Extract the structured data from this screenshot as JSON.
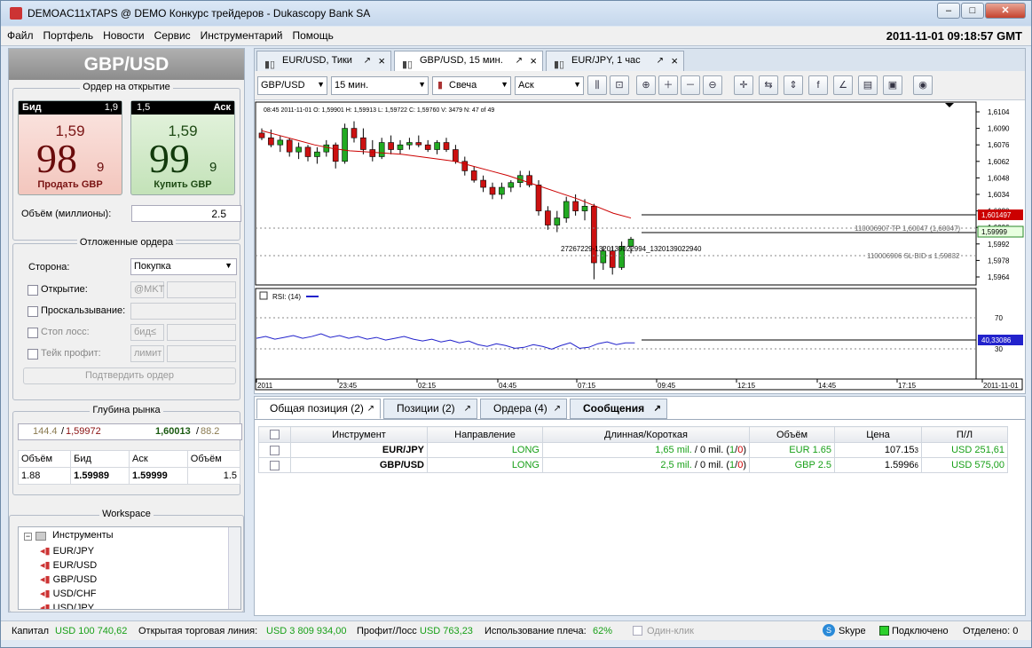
{
  "window": {
    "title": "DEMOAC11xTAPS @ DEMO Конкурс трейдеров - Dukascopy Bank SA",
    "min": "‒",
    "max": "□",
    "close": "✕"
  },
  "menu": [
    "Файл",
    "Портфель",
    "Новости",
    "Сервис",
    "Инструментарий",
    "Помощь"
  ],
  "clock": "2011-11-01 09:18:57 GMT",
  "left": {
    "instrument": "GBP/USD",
    "order_title": "Ордер на открытие",
    "bid": {
      "label": "Бид",
      "spread": "1,9",
      "small": "1,59",
      "big": "98",
      "sup": "9",
      "action": "Продать GBP"
    },
    "ask": {
      "label": "Аск",
      "spread": "1,5",
      "small": "1,59",
      "big": "99",
      "sup": "9",
      "action": "Купить GBP"
    },
    "volume_label": "Объём (миллионы):",
    "volume": "2.5",
    "pending_title": "Отложенные ордера",
    "side_label": "Сторона:",
    "side": "Покупка",
    "open_label": "Открытие:",
    "open_ph": "@MKT",
    "slip_label": "Проскальзывание:",
    "sl_label": "Стоп лосс:",
    "sl_ph": "бид≤",
    "tp_label": "Тейк профит:",
    "tp_ph": "лимит",
    "confirm": "Подтвердить ордер",
    "depth_title": "Глубина рынка",
    "depth": {
      "bid_vol": "144.4",
      "bid": "1,59972",
      "ask": "1,60013",
      "ask_vol": "88.2"
    },
    "depth_cols": [
      "Объём",
      "Бид",
      "Аск",
      "Объём"
    ],
    "depth_row": [
      "1.88",
      "1.59989",
      "1.59999",
      "1.5"
    ],
    "workspace_title": "Workspace",
    "tree_root": "Инструменты",
    "tree": [
      "EUR/JPY",
      "EUR/USD",
      "GBP/USD",
      "USD/CHF",
      "USD/JPY"
    ]
  },
  "tabs": [
    {
      "label": "EUR/USD, Тики"
    },
    {
      "label": "GBP/USD, 15 мин."
    },
    {
      "label": "EUR/JPY, 1 час"
    }
  ],
  "toolbar": {
    "instrument": "GBP/USD",
    "period": "15 мин.",
    "type": "Свеча",
    "side": "Аск"
  },
  "chart_data": {
    "type": "candlestick",
    "info": "08:45 2011-11-01   O: 1,59901   H: 1,59913   L: 1,59722   C: 1,59760   V: 3479   N: 47 of 49",
    "yticks": [
      "1,6104",
      "1,6090",
      "1,6076",
      "1,6062",
      "1,6048",
      "1,6034",
      "1,6020",
      "1,6006",
      "1,5992",
      "1,5978",
      "1,5964"
    ],
    "ylim": [
      1.5964,
      1.6104
    ],
    "xticks": [
      "2011",
      "23:45",
      "02:15",
      "04:45",
      "07:15",
      "09:45",
      "12:15",
      "14:45",
      "17:15",
      "2011-11-01"
    ],
    "candles": [
      [
        1.6086,
        1.609,
        1.608,
        1.6082
      ],
      [
        1.6082,
        1.6089,
        1.6074,
        1.6076
      ],
      [
        1.6076,
        1.6084,
        1.607,
        1.608
      ],
      [
        1.608,
        1.6082,
        1.6066,
        1.607
      ],
      [
        1.607,
        1.6078,
        1.6064,
        1.6074
      ],
      [
        1.6074,
        1.6076,
        1.6062,
        1.6066
      ],
      [
        1.6066,
        1.6074,
        1.606,
        1.607
      ],
      [
        1.607,
        1.608,
        1.6066,
        1.6076
      ],
      [
        1.6076,
        1.6078,
        1.6056,
        1.6062
      ],
      [
        1.6062,
        1.6094,
        1.606,
        1.609
      ],
      [
        1.609,
        1.6096,
        1.6078,
        1.6082
      ],
      [
        1.6082,
        1.609,
        1.6068,
        1.6072
      ],
      [
        1.6072,
        1.608,
        1.6062,
        1.6066
      ],
      [
        1.6066,
        1.6082,
        1.6064,
        1.6078
      ],
      [
        1.6078,
        1.6084,
        1.6068,
        1.6072
      ],
      [
        1.6072,
        1.608,
        1.6068,
        1.6076
      ],
      [
        1.6076,
        1.6082,
        1.6072,
        1.6078
      ],
      [
        1.6078,
        1.6084,
        1.6074,
        1.6076
      ],
      [
        1.6076,
        1.608,
        1.607,
        1.6072
      ],
      [
        1.6072,
        1.608,
        1.6068,
        1.6078
      ],
      [
        1.6078,
        1.6082,
        1.607,
        1.6072
      ],
      [
        1.6072,
        1.6076,
        1.606,
        1.6062
      ],
      [
        1.6062,
        1.6066,
        1.605,
        1.6054
      ],
      [
        1.6054,
        1.6058,
        1.6044,
        1.6046
      ],
      [
        1.6046,
        1.605,
        1.6036,
        1.604
      ],
      [
        1.604,
        1.6044,
        1.603,
        1.6034
      ],
      [
        1.6034,
        1.6044,
        1.603,
        1.604
      ],
      [
        1.604,
        1.6046,
        1.6036,
        1.6044
      ],
      [
        1.6044,
        1.6054,
        1.604,
        1.605
      ],
      [
        1.605,
        1.6054,
        1.604,
        1.6042
      ],
      [
        1.6042,
        1.6046,
        1.6016,
        1.602
      ],
      [
        1.602,
        1.6024,
        1.6004,
        1.6008
      ],
      [
        1.6008,
        1.602,
        1.6002,
        1.6014
      ],
      [
        1.6014,
        1.6032,
        1.601,
        1.6028
      ],
      [
        1.6028,
        1.6034,
        1.6016,
        1.602
      ],
      [
        1.602,
        1.603,
        1.6012,
        1.6024
      ],
      [
        1.6024,
        1.6026,
        1.5962,
        1.5976
      ],
      [
        1.5976,
        1.599,
        1.597,
        1.5986
      ],
      [
        1.5986,
        1.599,
        1.5966,
        1.5972
      ],
      [
        1.5972,
        1.5994,
        1.597,
        1.599
      ],
      [
        1.599,
        1.5998,
        1.5984,
        1.5996
      ]
    ],
    "ma_label": "",
    "ma": [
      1.6088,
      1.6084,
      1.608,
      1.6076,
      1.6073,
      1.6071,
      1.607,
      1.6069,
      1.6068,
      1.6066,
      1.6064,
      1.6062,
      1.6058,
      1.6054,
      1.605,
      1.6045,
      1.604,
      1.6035,
      1.603,
      1.6024,
      1.6018,
      1.6014
    ],
    "bid_badge": "1,601497",
    "ask_badge": "1,59999",
    "tp_label": "110006907 TP 1,60047 (1,60047)",
    "sl_label": "110006906 SL BID ≤ 1,59832",
    "trade_label": "27267229-1320139022994_1320139022940",
    "rsi_label": "RSI: (14)",
    "rsi_levels": [
      "70",
      "30"
    ],
    "rsi_badge": "40,33086",
    "rsi": [
      45,
      47,
      44,
      46,
      48,
      45,
      47,
      50,
      46,
      48,
      45,
      47,
      44,
      46,
      43,
      45,
      47,
      44,
      42,
      44,
      41,
      43,
      40,
      42,
      38,
      36,
      39,
      37,
      34,
      35,
      38,
      36,
      33,
      37,
      40,
      34,
      35,
      39,
      41,
      38,
      40,
      40
    ]
  },
  "bottom_tabs": [
    {
      "label": "Общая позиция (2)"
    },
    {
      "label": "Позиции (2)"
    },
    {
      "label": "Ордера (4)"
    },
    {
      "label": "Сообщения"
    }
  ],
  "positions": {
    "cols": [
      "",
      "Инструмент",
      "Направление",
      "Длинная/Короткая",
      "Объём",
      "Цена",
      "П/Л"
    ],
    "rows": [
      {
        "inst": "EUR/JPY",
        "dir": "LONG",
        "lpre": "1,65 mil. ",
        "lmid": "/ 0 mil. (",
        "l1": "1",
        "ls": "/",
        "l0": "0",
        "lend": ")",
        "vol": "EUR 1.65",
        "price": "107.15",
        "pf": "3",
        "pl": "USD 251,61"
      },
      {
        "inst": "GBP/USD",
        "dir": "LONG",
        "lpre": "2,5 mil. ",
        "lmid": "/ 0 mil. (",
        "l1": "1",
        "ls": "/",
        "l0": "0",
        "lend": ")",
        "vol": "GBP 2.5",
        "price": "1.5996",
        "pf": "6",
        "pl": "USD 575,00"
      }
    ]
  },
  "status": {
    "capital_label": "Капитал",
    "capital": "USD 100 740,62",
    "line_label": "Открытая торговая линия:",
    "line": "USD 3 809 934,00",
    "pl_label": "Профит/Лосс",
    "pl": "USD 763,23",
    "lev_label": "Использование плеча:",
    "lev": "62%",
    "oneclick": "Один-клик",
    "skype": "Skype",
    "conn": "Подключено",
    "detached": "Отделено: 0"
  }
}
